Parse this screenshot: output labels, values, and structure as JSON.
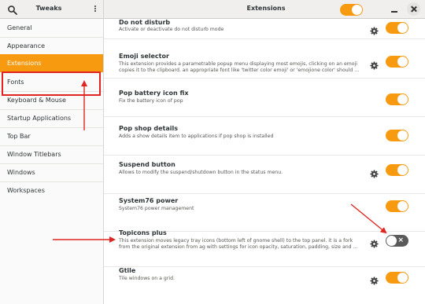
{
  "titlebar": {
    "app_title": "Tweaks",
    "page_title": "Extensions"
  },
  "sidebar": {
    "items": [
      {
        "label": "General"
      },
      {
        "label": "Appearance"
      },
      {
        "label": "Extensions",
        "active": true
      },
      {
        "label": "Fonts"
      },
      {
        "label": "Keyboard & Mouse"
      },
      {
        "label": "Startup Applications"
      },
      {
        "label": "Top Bar"
      },
      {
        "label": "Window Titlebars"
      },
      {
        "label": "Windows"
      },
      {
        "label": "Workspaces"
      }
    ]
  },
  "extensions": [
    {
      "name": "Do not disturb",
      "description": "Activate or deactivate do not disturb mode",
      "has_settings": true,
      "enabled": true
    },
    {
      "name": "Emoji selector",
      "description": "This extension provides a parametrable popup menu displaying most emojis, clicking on an emoji copies it to the clipboard. an appropriate font like 'twitter color emoji' or 'emojione color' should ...",
      "has_settings": true,
      "enabled": true
    },
    {
      "name": "Pop battery icon fix",
      "description": "Fix the battery icon of pop",
      "has_settings": false,
      "enabled": true
    },
    {
      "name": "Pop shop details",
      "description": "Adds a show details item to applications if pop shop is installed",
      "has_settings": false,
      "enabled": true
    },
    {
      "name": "Suspend button",
      "description": "Allows to modify the suspend/shutdown button in the status menu.",
      "has_settings": true,
      "enabled": true
    },
    {
      "name": "System76 power",
      "description": "System76 power management",
      "has_settings": false,
      "enabled": true
    },
    {
      "name": "Topicons plus",
      "description": "This extension moves legacy tray icons (bottom left of gnome shell) to the top panel. it is a fork from the original extension from ag  with settings for icon opacity, saturation, padding, size and ...",
      "has_settings": true,
      "enabled": false
    },
    {
      "name": "Gtile",
      "description": "Tile windows on a grid.",
      "has_settings": true,
      "enabled": true
    }
  ],
  "colors": {
    "accent": "#f89a0f",
    "annotation": "#e0241f",
    "toggle_off": "#5a5a5a"
  },
  "icons": {
    "search": "search-icon",
    "menu": "vertical-dots-icon",
    "settings": "gear-icon",
    "close": "close-icon",
    "minimize": "minimize-icon"
  }
}
